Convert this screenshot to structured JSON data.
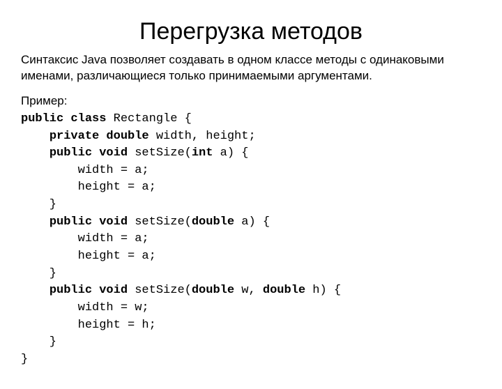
{
  "title": "Перегрузка методов",
  "description": "Синтаксис Java позволяет создавать в одном классе методы с одинаковыми именами, различающиеся только принимаемыми аргументами.",
  "example_label": "Пример:",
  "code": {
    "kw_public_class": "public class",
    "class_name": " Rectangle {",
    "kw_private_double": "private double",
    "fields": " width, height;",
    "kw_public_void_1": "public void",
    "sig1a": " setSize(",
    "kw_int": "int",
    "sig1b": " a) {",
    "body1a": "        width = a;",
    "body1b": "        height = a;",
    "close1": "    }",
    "kw_public_void_2": "public void",
    "sig2a": " setSize(",
    "kw_double_2": "double",
    "sig2b": " a) {",
    "body2a": "        width = a;",
    "body2b": "        height = a;",
    "close2": "    }",
    "kw_public_void_3": "public void",
    "sig3a": " setSize(",
    "kw_double_3a": "double",
    "sig3mid": " w, ",
    "kw_double_3b": "double",
    "sig3b": " h) {",
    "body3a": "        width = w;",
    "body3b": "        height = h;",
    "close3": "    }",
    "close_class": "}"
  }
}
